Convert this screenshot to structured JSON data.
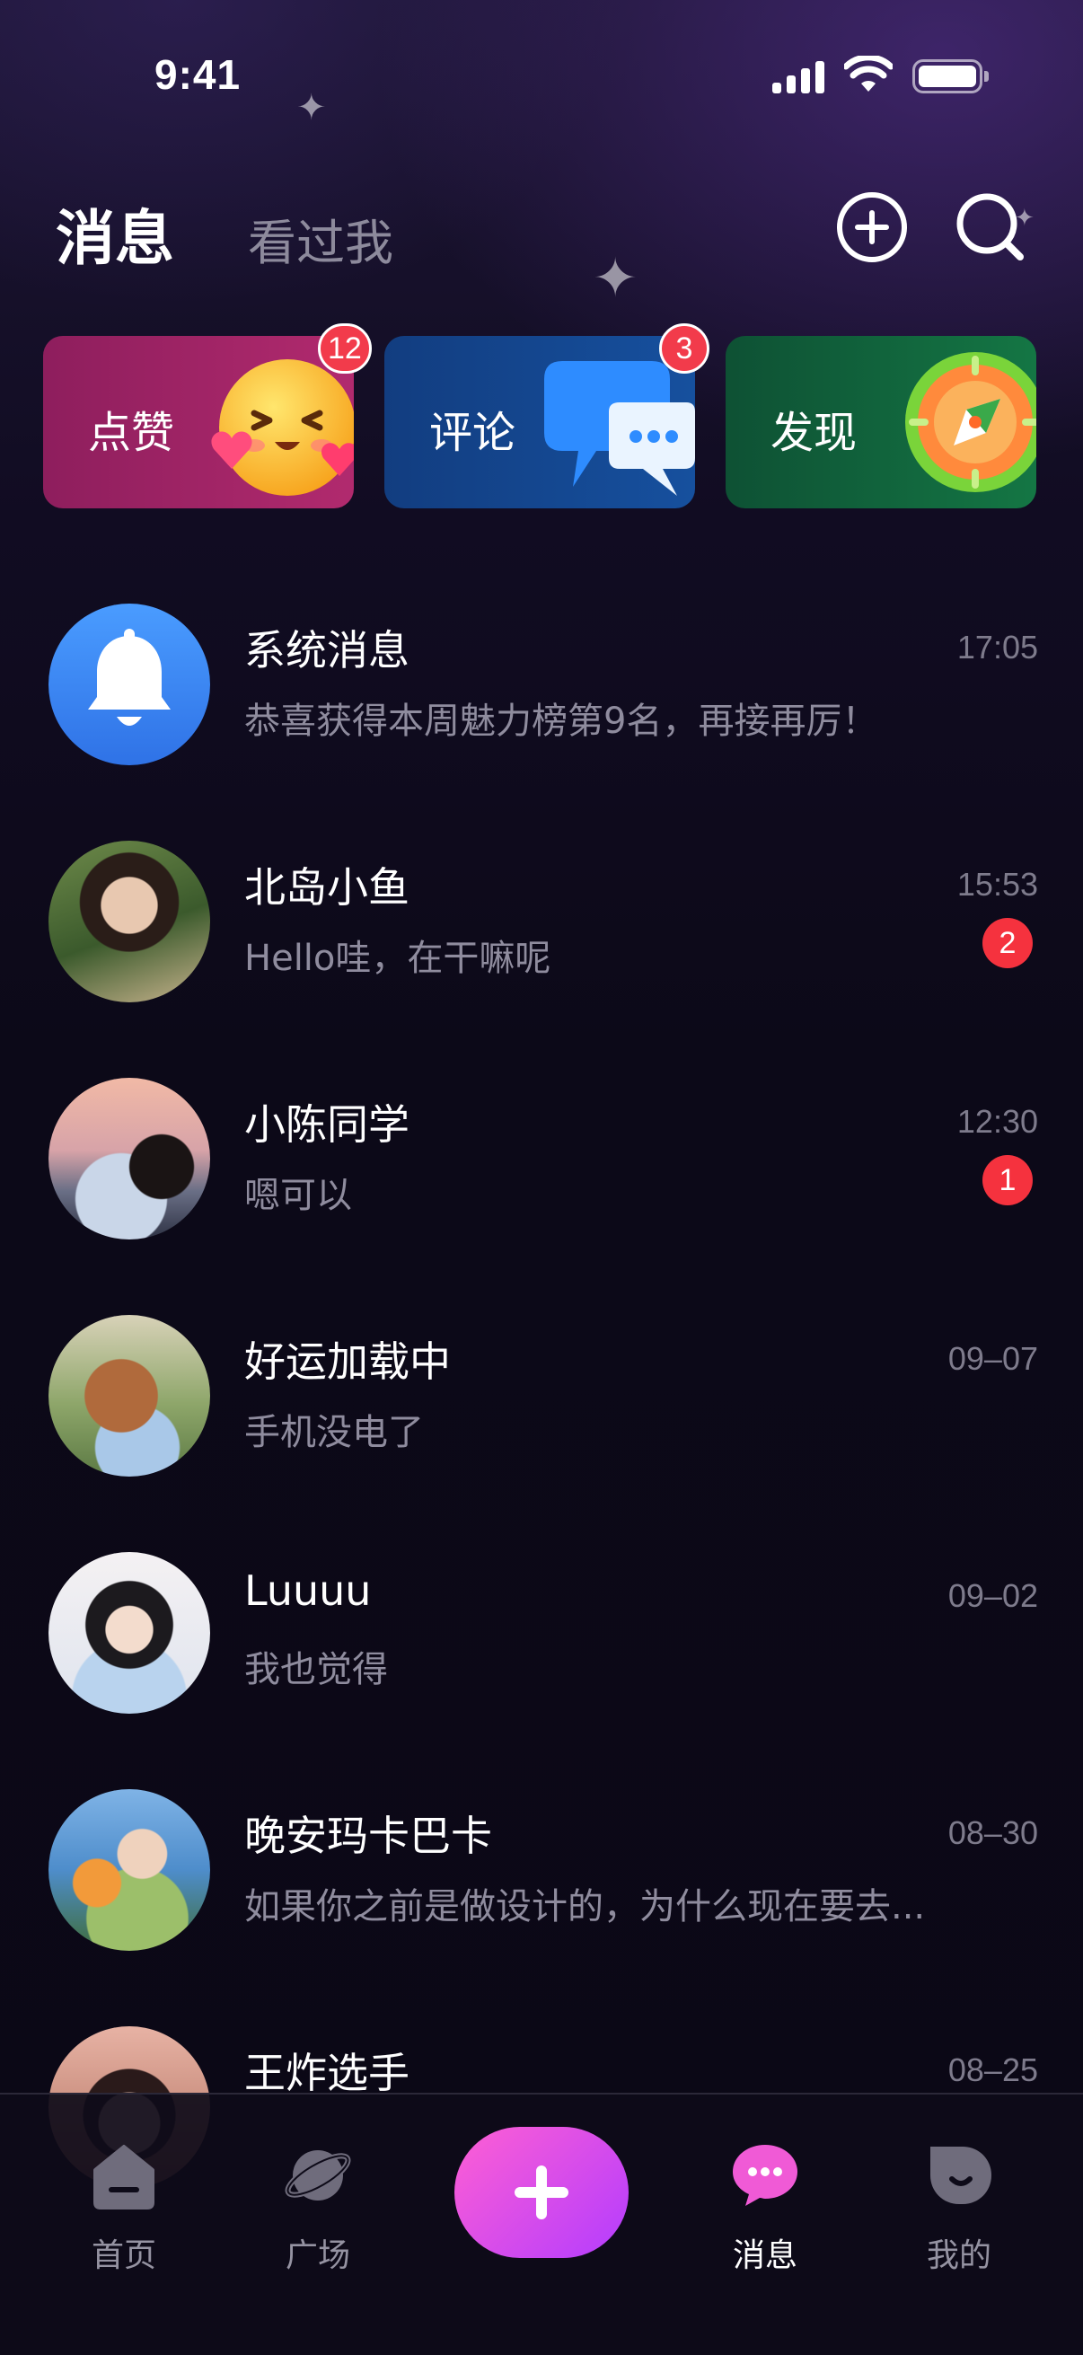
{
  "status_bar": {
    "time": "9:41"
  },
  "header": {
    "tab_active": "消息",
    "tab_inactive": "看过我",
    "add_icon": "plus-circle-icon",
    "search_icon": "search-icon"
  },
  "cards": [
    {
      "label": "点赞",
      "badge": "12",
      "icon": "smiley-hearts-icon",
      "color": "#a0245f"
    },
    {
      "label": "评论",
      "badge": "3",
      "icon": "chat-bubbles-icon",
      "color": "#14478f"
    },
    {
      "label": "发现",
      "icon": "compass-icon",
      "color": "#12643c"
    }
  ],
  "conversations": [
    {
      "name": "系统消息",
      "preview": "恭喜获得本周魅力榜第9名，再接再厉！",
      "time": "17:05",
      "avatar": "bell-icon"
    },
    {
      "name": "北岛小鱼",
      "preview": "Hello哇，在干嘛呢",
      "time": "15:53",
      "unread": "2"
    },
    {
      "name": "小陈同学",
      "preview": "嗯可以",
      "time": "12:30",
      "unread": "1"
    },
    {
      "name": "好运加载中",
      "preview": "手机没电了",
      "time": "09–07"
    },
    {
      "name": "Luuuu",
      "preview": "我也觉得",
      "time": "09–02"
    },
    {
      "name": "晚安玛卡巴卡",
      "preview": "如果你之前是做设计的，为什么现在要去...",
      "time": "08–30"
    },
    {
      "name": "王炸选手",
      "preview": "",
      "time": "08–25"
    }
  ],
  "bottom_nav": {
    "items": [
      {
        "label": "首页",
        "icon": "home-icon"
      },
      {
        "label": "广场",
        "icon": "planet-icon"
      },
      {
        "label": "消息",
        "icon": "message-icon",
        "active": true
      },
      {
        "label": "我的",
        "icon": "profile-icon"
      }
    ],
    "add_icon": "plus-icon"
  },
  "colors": {
    "accent_pink": "#f05ad6",
    "badge_red": "#f5323e",
    "background": "#0b0816"
  }
}
